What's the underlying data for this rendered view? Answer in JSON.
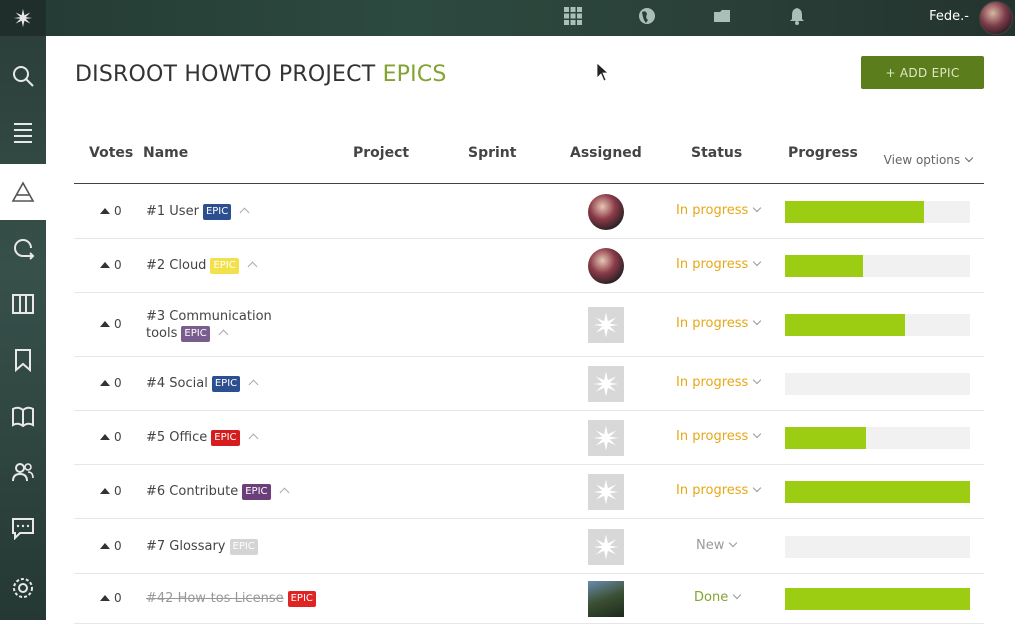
{
  "topbar": {
    "user_name": "Fede.-",
    "icons": [
      "flower-logo-icon",
      "grid-icon",
      "globe-icon",
      "folder-icon",
      "bell-icon"
    ]
  },
  "sidebar": {
    "items": [
      {
        "name": "search",
        "icon": "search-icon"
      },
      {
        "name": "backlog",
        "icon": "list-icon"
      },
      {
        "name": "epics",
        "icon": "epic-triangle-icon",
        "active": true
      },
      {
        "name": "sprints",
        "icon": "sprint-icon"
      },
      {
        "name": "kanban",
        "icon": "kanban-icon"
      },
      {
        "name": "issues",
        "icon": "bookmark-icon"
      },
      {
        "name": "wiki",
        "icon": "book-icon"
      },
      {
        "name": "team",
        "icon": "team-icon"
      },
      {
        "name": "chat",
        "icon": "chat-icon"
      },
      {
        "name": "settings",
        "icon": "gear-icon"
      }
    ]
  },
  "header": {
    "title_main": "DISROOT HOWTO PROJECT ",
    "title_accent": "EPICS",
    "add_button": "+ ADD EPIC"
  },
  "table": {
    "columns": {
      "votes": "Votes",
      "name": "Name",
      "project": "Project",
      "sprint": "Sprint",
      "assigned": "Assigned",
      "status": "Status",
      "progress": "Progress"
    },
    "view_options": "View options",
    "rows": [
      {
        "votes": "0",
        "name_line1": "#1 User",
        "name_line2": "",
        "badge": "EPIC",
        "badge_color": "#2c4f8f",
        "assignee": "photo",
        "status": "In progress",
        "status_color": "#e6a817",
        "progress": 0.75,
        "done": false
      },
      {
        "votes": "0",
        "name_line1": "#2 Cloud",
        "name_line2": "",
        "badge": "EPIC",
        "badge_color": "#f2e14b",
        "assignee": "photo",
        "status": "In progress",
        "status_color": "#e6a817",
        "progress": 0.42,
        "done": false
      },
      {
        "votes": "0",
        "name_line1": "#3 Communication",
        "name_line2": "tools",
        "badge": "EPIC",
        "badge_color": "#7a5d8f",
        "assignee": "placeholder",
        "status": "In progress",
        "status_color": "#e6a817",
        "progress": 0.65,
        "done": false
      },
      {
        "votes": "0",
        "name_line1": "#4 Social",
        "name_line2": "",
        "badge": "EPIC",
        "badge_color": "#2c4f8f",
        "assignee": "placeholder",
        "status": "In progress",
        "status_color": "#e6a817",
        "progress": 0.0,
        "done": false
      },
      {
        "votes": "0",
        "name_line1": "#5 Office",
        "name_line2": "",
        "badge": "EPIC",
        "badge_color": "#d61d1d",
        "assignee": "placeholder",
        "status": "In progress",
        "status_color": "#e6a817",
        "progress": 0.44,
        "done": false
      },
      {
        "votes": "0",
        "name_line1": "#6 Contribute",
        "name_line2": "",
        "badge": "EPIC",
        "badge_color": "#6a3f7a",
        "assignee": "placeholder",
        "status": "In progress",
        "status_color": "#e6a817",
        "progress": 1.0,
        "done": false
      },
      {
        "votes": "0",
        "name_line1": "#7 Glossary",
        "name_line2": "",
        "badge": "EPIC",
        "badge_color": "#d4d4d4",
        "assignee": "placeholder",
        "status": "New",
        "status_color": "#999999",
        "progress": 0.0,
        "done": false
      },
      {
        "votes": "0",
        "name_line1": "#42 How-tos License",
        "name_line2": "",
        "badge": "EPIC",
        "badge_color": "#e02424",
        "assignee": "photo2",
        "status": "Done",
        "status_color": "#83a330",
        "progress": 1.0,
        "done": true
      }
    ]
  }
}
